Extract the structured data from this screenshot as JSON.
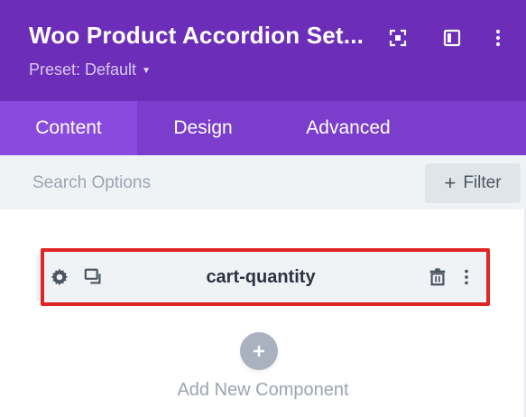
{
  "header": {
    "title": "Woo Product Accordion Set...",
    "preset": "Preset: Default",
    "icons": [
      "expand-icon",
      "sidebar-panel-icon",
      "more-vertical-icon"
    ],
    "background": "#6c2eb9"
  },
  "tabs": [
    {
      "label": "Content",
      "active": true
    },
    {
      "label": "Design",
      "active": false
    },
    {
      "label": "Advanced",
      "active": false
    }
  ],
  "search": {
    "placeholder": "Search Options",
    "value": ""
  },
  "filter": {
    "label": "Filter",
    "icon": "plus-icon"
  },
  "component": {
    "label": "cart-quantity",
    "icons": [
      "gear-icon",
      "duplicate-icon",
      "trash-icon",
      "more-vertical-icon"
    ],
    "highlight_color": "#e02424"
  },
  "add_component": {
    "label": "Add New Component",
    "icon": "plus-icon"
  },
  "colors": {
    "accent": "#7b3dcc",
    "active_tab": "#8a4ae0",
    "muted_text": "#9aa4b1"
  }
}
